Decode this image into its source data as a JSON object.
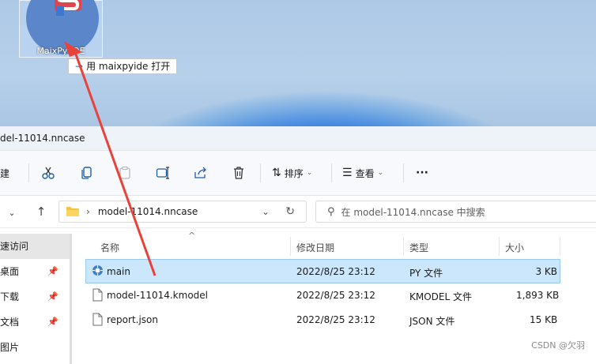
{
  "desktop": {
    "icon_label": "MaixPy IDE",
    "tooltip": "用 maixpyide 打开",
    "colors": {
      "wallpaper": "#b7d0ea",
      "bloom": "#1f6fe0",
      "arrow": "#e8423a"
    }
  },
  "window": {
    "title": "del-11014.nncase"
  },
  "toolbar": {
    "new_label": "建",
    "sort_label": "排序",
    "view_label": "查看",
    "more_label": "···"
  },
  "address": {
    "path": "model-11014.nncase",
    "search_placeholder": "在 model-11014.nncase 中搜索"
  },
  "sidebar": {
    "items": [
      {
        "label": "速访问",
        "pinned": false
      },
      {
        "label": "桌面",
        "pinned": true
      },
      {
        "label": "下载",
        "pinned": true
      },
      {
        "label": "文档",
        "pinned": true
      },
      {
        "label": "图片",
        "pinned": false
      }
    ]
  },
  "columns": {
    "name": "名称",
    "date": "修改日期",
    "type": "类型",
    "size": "大小"
  },
  "files": [
    {
      "name": "main",
      "date": "2022/8/25 23:12",
      "type": "PY 文件",
      "size": "3 KB",
      "icon": "python-file-icon",
      "selected": true
    },
    {
      "name": "model-11014.kmodel",
      "date": "2022/8/25 23:12",
      "type": "KMODEL 文件",
      "size": "1,893 KB",
      "icon": "file-icon",
      "selected": false
    },
    {
      "name": "report.json",
      "date": "2022/8/25 23:12",
      "type": "JSON 文件",
      "size": "15 KB",
      "icon": "file-icon",
      "selected": false
    }
  ],
  "watermark": "CSDN @欠羽"
}
